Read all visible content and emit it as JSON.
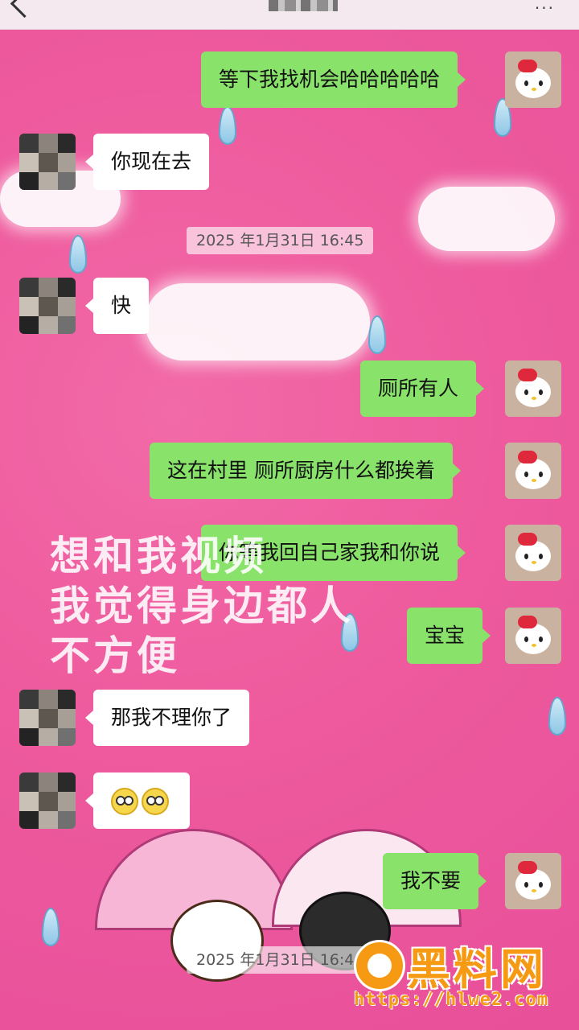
{
  "header": {
    "back_icon": "chevron-left-icon",
    "more_icon": "more-dots-icon",
    "more_label": "···"
  },
  "messages": [
    {
      "side": "out",
      "text": "等下我找机会哈哈哈哈哈"
    },
    {
      "side": "in",
      "text": "你现在去"
    },
    {
      "side": "time",
      "text": "2025 年1月31日 16:45"
    },
    {
      "side": "in",
      "text": "快"
    },
    {
      "side": "out",
      "text": "厕所有人"
    },
    {
      "side": "out",
      "text": "这在村里  厕所厨房什么都挨着"
    },
    {
      "side": "out",
      "text": "你等我回自己家我和你说"
    },
    {
      "side": "out",
      "text": "宝宝"
    },
    {
      "side": "in",
      "text": "那我不理你了"
    },
    {
      "side": "in",
      "emoji": [
        "dizzy-face-emoji",
        "dizzy-face-emoji"
      ]
    },
    {
      "side": "out",
      "text": "我不要"
    },
    {
      "side": "time",
      "text": "2025 年1月31日 16:46"
    }
  ],
  "overlay": {
    "lines": [
      "想和我视频",
      "我觉得身边都人",
      "不方便"
    ]
  },
  "watermark": {
    "name": "黑料网",
    "url": "https://hlwe2.com"
  },
  "colors": {
    "background": "#ee5a9d",
    "outgoing_bubble": "#89e26a",
    "incoming_bubble": "#ffffff",
    "watermark": "#f59a12"
  }
}
